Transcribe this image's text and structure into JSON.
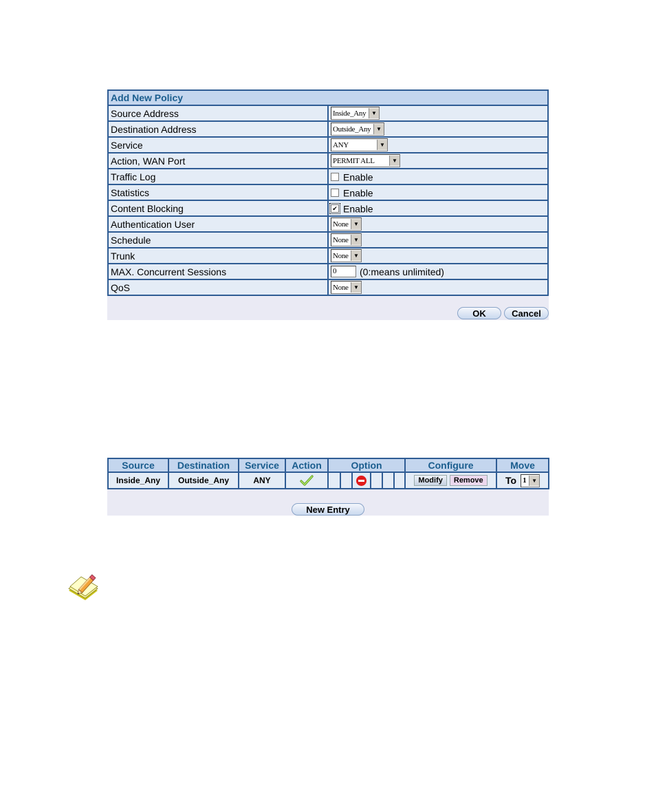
{
  "form": {
    "title": "Add New Policy",
    "rows": [
      {
        "label": "Source Address",
        "type": "select",
        "value": "Inside_Any"
      },
      {
        "label": "Destination Address",
        "type": "select",
        "value": "Outside_Any"
      },
      {
        "label": "Service",
        "type": "select",
        "value": "ANY"
      },
      {
        "label": "Action, WAN Port",
        "type": "select",
        "value": "PERMIT ALL"
      },
      {
        "label": "Traffic Log",
        "type": "checkbox",
        "checked": false,
        "option": "Enable"
      },
      {
        "label": "Statistics",
        "type": "checkbox",
        "checked": false,
        "option": "Enable"
      },
      {
        "label": "Content Blocking",
        "type": "checkbox",
        "checked": true,
        "option": "Enable"
      },
      {
        "label": "Authentication User",
        "type": "select",
        "value": "None"
      },
      {
        "label": "Schedule",
        "type": "select",
        "value": "None"
      },
      {
        "label": "Trunk",
        "type": "select",
        "value": "None"
      },
      {
        "label": "MAX. Concurrent Sessions",
        "type": "text",
        "value": "0",
        "hint": "(0:means unlimited)"
      },
      {
        "label": "QoS",
        "type": "select",
        "value": "None"
      }
    ],
    "ok_label": "OK",
    "cancel_label": "Cancel"
  },
  "policy_list": {
    "headers": [
      "Source",
      "Destination",
      "Service",
      "Action",
      "Option",
      "Configure",
      "Move"
    ],
    "rows": [
      {
        "source": "Inside_Any",
        "destination": "Outside_Any",
        "service": "ANY",
        "action_icon": "check-icon",
        "options": [
          "",
          "",
          "stop-icon",
          "",
          "",
          ""
        ],
        "modify_label": "Modify",
        "remove_label": "Remove",
        "move_prefix": "To",
        "move_value": "1"
      }
    ],
    "new_entry_label": "New Entry"
  },
  "note": {
    "icon": "note-pencil-icon"
  },
  "colors": {
    "border": "#2f5c94",
    "header_bg": "#c4d6ee",
    "header_text": "#1a5d8e",
    "cell_bg": "#e4ecf6",
    "footer_bg": "#eaeaf4",
    "stop_red": "#e21b1b",
    "check_green": "#7ac22a"
  }
}
